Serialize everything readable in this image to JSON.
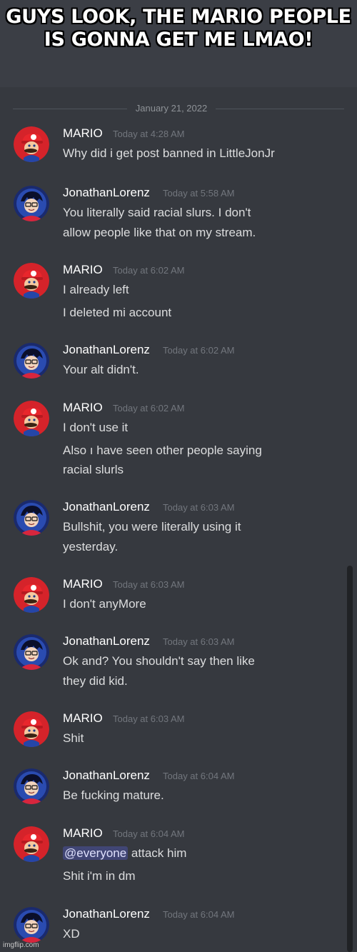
{
  "caption": "GUYS LOOK, THE MARIO PEOPLE IS GONNA GET ME LMAO!",
  "date_divider": "January 21, 2022",
  "colors": {
    "background": "#36393f",
    "mario_avatar": "#d5232a",
    "jonathan_avatar": "#1a2a6e",
    "mention_bg": "#414675"
  },
  "messages": [
    {
      "author": "MARIO",
      "time": "Today at 4:28 AM",
      "lines": [
        "Why did i get post banned in LittleJonJr"
      ]
    },
    {
      "author": "JonathanLorenz",
      "time": "Today at 5:58 AM",
      "lines": [
        "You literally said racial slurs. I don't",
        "allow people like that on my stream."
      ]
    },
    {
      "author": "MARIO",
      "time": "Today at 6:02 AM",
      "lines": [
        "I already left",
        "I deleted mi account"
      ]
    },
    {
      "author": "JonathanLorenz",
      "time": "Today at 6:02 AM",
      "lines": [
        "Your alt didn't."
      ]
    },
    {
      "author": "MARIO",
      "time": "Today at 6:02 AM",
      "lines": [
        "I don't use it",
        "Also ı have seen other people saying",
        "racial slurls"
      ]
    },
    {
      "author": "JonathanLorenz",
      "time": "Today at 6:03 AM",
      "lines": [
        "Bullshit, you were literally using it",
        "yesterday."
      ]
    },
    {
      "author": "MARIO",
      "time": "Today at 6:03 AM",
      "lines": [
        "I don't anyMore"
      ]
    },
    {
      "author": "JonathanLorenz",
      "time": "Today at 6:03 AM",
      "lines": [
        "Ok and? You shouldn't say then like",
        "they did  kid."
      ]
    },
    {
      "author": "MARIO",
      "time": "Today at 6:03 AM",
      "lines": [
        "Shit"
      ]
    },
    {
      "author": "JonathanLorenz",
      "time": "Today at 6:04 AM",
      "lines": [
        "Be fucking mature."
      ]
    },
    {
      "author": "MARIO",
      "time": "Today at 6:04 AM",
      "mention": "@everyone",
      "lines": [
        " attack him",
        "Shit i'm in dm"
      ]
    },
    {
      "author": "JonathanLorenz",
      "time": "Today at 6:04 AM",
      "lines": [
        "XD"
      ]
    }
  ],
  "watermark": "imgflip.com"
}
